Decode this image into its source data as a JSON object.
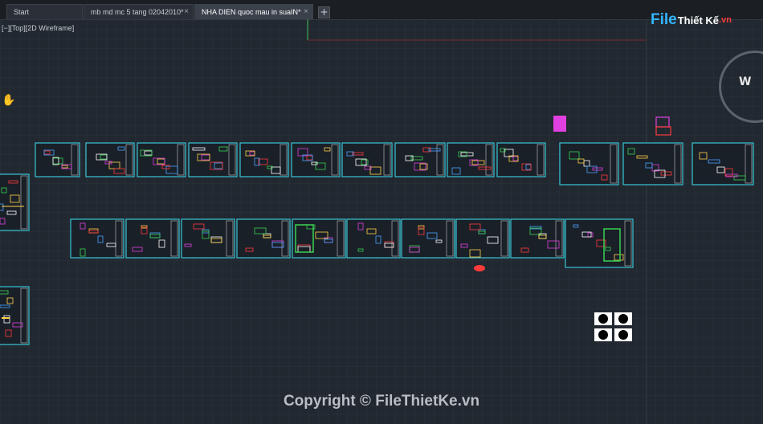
{
  "tabs": [
    {
      "label": "Start",
      "active": false
    },
    {
      "label": "mb md mc 5 tang 02042010*",
      "active": false
    },
    {
      "label": "NHA DIEN quoc mau in suaIN*",
      "active": true
    }
  ],
  "new_tab_symbol": "+",
  "close_symbol": "×",
  "viewport": {
    "label": "[−][Top][2D Wireframe]"
  },
  "brand": {
    "part1": "File",
    "part2": "Thiết Kế",
    "part3": ".vn"
  },
  "viewcube": {
    "direction": "W"
  },
  "hand_icon": "pan-hand-icon",
  "watermark": {
    "text": "Copyright © FileThietKe.vn"
  },
  "colors": {
    "background": "#212830",
    "sheet_frame": "#39c5d6",
    "accent_magenta": "#e040e0",
    "accent_red": "#ff3b3b",
    "accent_green": "#39d353"
  }
}
